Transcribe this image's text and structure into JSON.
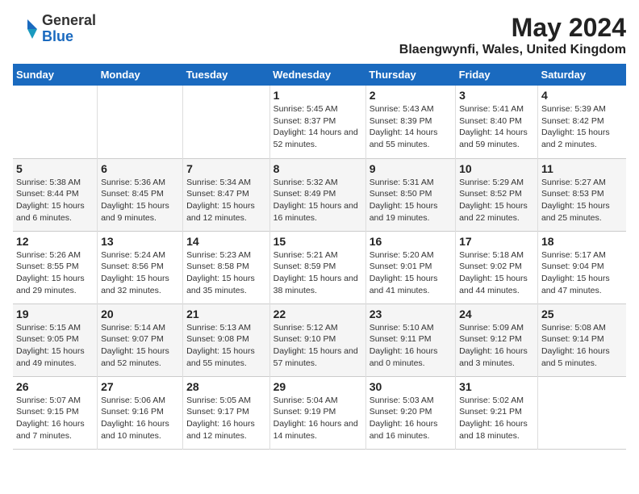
{
  "logo": {
    "general": "General",
    "blue": "Blue"
  },
  "title": "May 2024",
  "subtitle": "Blaengwynfi, Wales, United Kingdom",
  "days_of_week": [
    "Sunday",
    "Monday",
    "Tuesday",
    "Wednesday",
    "Thursday",
    "Friday",
    "Saturday"
  ],
  "weeks": [
    [
      {
        "day": "",
        "info": ""
      },
      {
        "day": "",
        "info": ""
      },
      {
        "day": "",
        "info": ""
      },
      {
        "day": "1",
        "info": "Sunrise: 5:45 AM\nSunset: 8:37 PM\nDaylight: 14 hours and 52 minutes."
      },
      {
        "day": "2",
        "info": "Sunrise: 5:43 AM\nSunset: 8:39 PM\nDaylight: 14 hours and 55 minutes."
      },
      {
        "day": "3",
        "info": "Sunrise: 5:41 AM\nSunset: 8:40 PM\nDaylight: 14 hours and 59 minutes."
      },
      {
        "day": "4",
        "info": "Sunrise: 5:39 AM\nSunset: 8:42 PM\nDaylight: 15 hours and 2 minutes."
      }
    ],
    [
      {
        "day": "5",
        "info": "Sunrise: 5:38 AM\nSunset: 8:44 PM\nDaylight: 15 hours and 6 minutes."
      },
      {
        "day": "6",
        "info": "Sunrise: 5:36 AM\nSunset: 8:45 PM\nDaylight: 15 hours and 9 minutes."
      },
      {
        "day": "7",
        "info": "Sunrise: 5:34 AM\nSunset: 8:47 PM\nDaylight: 15 hours and 12 minutes."
      },
      {
        "day": "8",
        "info": "Sunrise: 5:32 AM\nSunset: 8:49 PM\nDaylight: 15 hours and 16 minutes."
      },
      {
        "day": "9",
        "info": "Sunrise: 5:31 AM\nSunset: 8:50 PM\nDaylight: 15 hours and 19 minutes."
      },
      {
        "day": "10",
        "info": "Sunrise: 5:29 AM\nSunset: 8:52 PM\nDaylight: 15 hours and 22 minutes."
      },
      {
        "day": "11",
        "info": "Sunrise: 5:27 AM\nSunset: 8:53 PM\nDaylight: 15 hours and 25 minutes."
      }
    ],
    [
      {
        "day": "12",
        "info": "Sunrise: 5:26 AM\nSunset: 8:55 PM\nDaylight: 15 hours and 29 minutes."
      },
      {
        "day": "13",
        "info": "Sunrise: 5:24 AM\nSunset: 8:56 PM\nDaylight: 15 hours and 32 minutes."
      },
      {
        "day": "14",
        "info": "Sunrise: 5:23 AM\nSunset: 8:58 PM\nDaylight: 15 hours and 35 minutes."
      },
      {
        "day": "15",
        "info": "Sunrise: 5:21 AM\nSunset: 8:59 PM\nDaylight: 15 hours and 38 minutes."
      },
      {
        "day": "16",
        "info": "Sunrise: 5:20 AM\nSunset: 9:01 PM\nDaylight: 15 hours and 41 minutes."
      },
      {
        "day": "17",
        "info": "Sunrise: 5:18 AM\nSunset: 9:02 PM\nDaylight: 15 hours and 44 minutes."
      },
      {
        "day": "18",
        "info": "Sunrise: 5:17 AM\nSunset: 9:04 PM\nDaylight: 15 hours and 47 minutes."
      }
    ],
    [
      {
        "day": "19",
        "info": "Sunrise: 5:15 AM\nSunset: 9:05 PM\nDaylight: 15 hours and 49 minutes."
      },
      {
        "day": "20",
        "info": "Sunrise: 5:14 AM\nSunset: 9:07 PM\nDaylight: 15 hours and 52 minutes."
      },
      {
        "day": "21",
        "info": "Sunrise: 5:13 AM\nSunset: 9:08 PM\nDaylight: 15 hours and 55 minutes."
      },
      {
        "day": "22",
        "info": "Sunrise: 5:12 AM\nSunset: 9:10 PM\nDaylight: 15 hours and 57 minutes."
      },
      {
        "day": "23",
        "info": "Sunrise: 5:10 AM\nSunset: 9:11 PM\nDaylight: 16 hours and 0 minutes."
      },
      {
        "day": "24",
        "info": "Sunrise: 5:09 AM\nSunset: 9:12 PM\nDaylight: 16 hours and 3 minutes."
      },
      {
        "day": "25",
        "info": "Sunrise: 5:08 AM\nSunset: 9:14 PM\nDaylight: 16 hours and 5 minutes."
      }
    ],
    [
      {
        "day": "26",
        "info": "Sunrise: 5:07 AM\nSunset: 9:15 PM\nDaylight: 16 hours and 7 minutes."
      },
      {
        "day": "27",
        "info": "Sunrise: 5:06 AM\nSunset: 9:16 PM\nDaylight: 16 hours and 10 minutes."
      },
      {
        "day": "28",
        "info": "Sunrise: 5:05 AM\nSunset: 9:17 PM\nDaylight: 16 hours and 12 minutes."
      },
      {
        "day": "29",
        "info": "Sunrise: 5:04 AM\nSunset: 9:19 PM\nDaylight: 16 hours and 14 minutes."
      },
      {
        "day": "30",
        "info": "Sunrise: 5:03 AM\nSunset: 9:20 PM\nDaylight: 16 hours and 16 minutes."
      },
      {
        "day": "31",
        "info": "Sunrise: 5:02 AM\nSunset: 9:21 PM\nDaylight: 16 hours and 18 minutes."
      },
      {
        "day": "",
        "info": ""
      }
    ]
  ]
}
